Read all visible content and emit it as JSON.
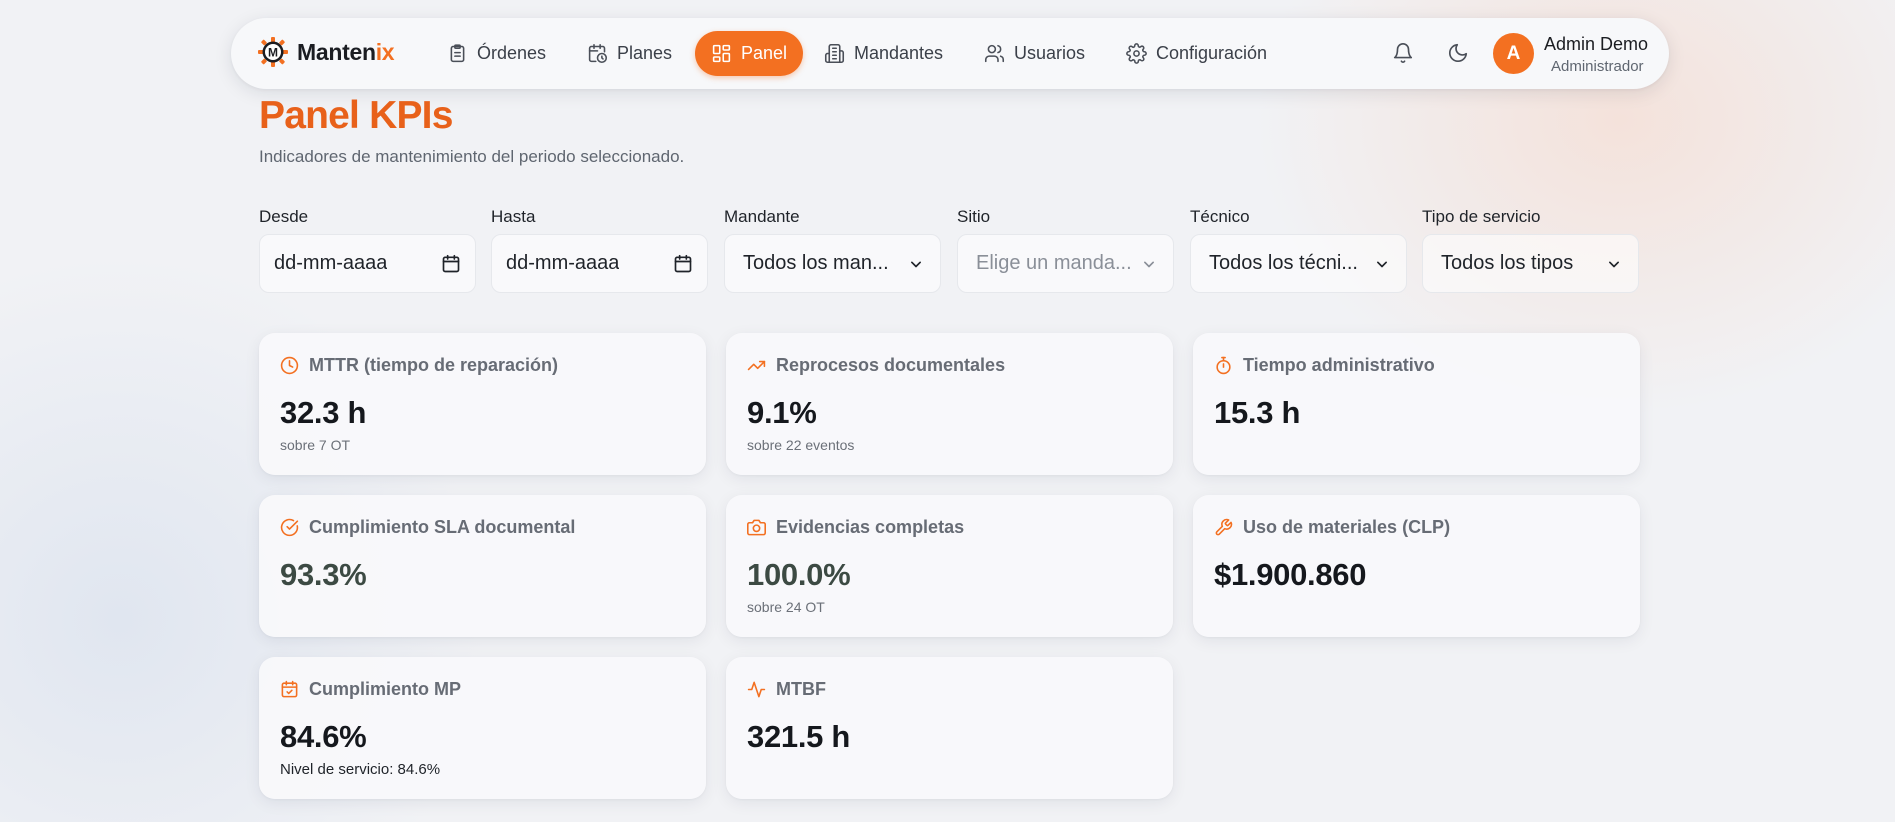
{
  "brand": {
    "part1": "Manten",
    "part2": "ix",
    "accent": "#f37021"
  },
  "nav": {
    "items": [
      {
        "label": "Órdenes",
        "icon": "clipboard-icon"
      },
      {
        "label": "Planes",
        "icon": "calendar-clock-icon"
      },
      {
        "label": "Panel",
        "icon": "dashboard-grid-icon",
        "active": true
      },
      {
        "label": "Mandantes",
        "icon": "building-icon"
      },
      {
        "label": "Usuarios",
        "icon": "users-icon"
      },
      {
        "label": "Configuración",
        "icon": "gear-icon"
      }
    ],
    "icons": [
      "bell-icon",
      "moon-icon"
    ]
  },
  "user": {
    "initial": "A",
    "name": "Admin Demo",
    "role": "Administrador"
  },
  "header": {
    "title": "Panel KPIs",
    "subtitle": "Indicadores de mantenimiento del periodo seleccionado."
  },
  "filters": [
    {
      "label": "Desde",
      "value": "dd-mm-aaaa",
      "type": "date"
    },
    {
      "label": "Hasta",
      "value": "dd-mm-aaaa",
      "type": "date"
    },
    {
      "label": "Mandante",
      "value": "Todos los man...",
      "type": "select"
    },
    {
      "label": "Sitio",
      "value": "Elige un manda...",
      "type": "select",
      "disabled": true
    },
    {
      "label": "Técnico",
      "value": "Todos los técni...",
      "type": "select"
    },
    {
      "label": "Tipo de servicio",
      "value": "Todos los tipos",
      "type": "select"
    }
  ],
  "kpis": [
    {
      "title": "MTTR (tiempo de reparación)",
      "value": "32.3 h",
      "sub": "sobre 7 OT",
      "icon": "clock-icon"
    },
    {
      "title": "Reprocesos documentales",
      "value": "9.1%",
      "sub": "sobre 22 eventos",
      "icon": "trending-up-icon"
    },
    {
      "title": "Tiempo administrativo",
      "value": "15.3 h",
      "sub": "",
      "icon": "stopwatch-icon"
    },
    {
      "title": "Cumplimiento SLA documental",
      "value": "93.3%",
      "sub": "",
      "icon": "check-circle-icon"
    },
    {
      "title": "Evidencias completas",
      "value": "100.0%",
      "sub": "sobre 24 OT",
      "icon": "camera-icon"
    },
    {
      "title": "Uso de materiales (CLP)",
      "value": "$1.900.860",
      "sub": "",
      "icon": "wrench-icon"
    },
    {
      "title": "Cumplimiento MP",
      "value": "84.6%",
      "sub": "Nivel de servicio: 84.6%",
      "icon": "calendar-check-icon"
    },
    {
      "title": "MTBF",
      "value": "321.5 h",
      "sub": "",
      "icon": "activity-icon"
    }
  ]
}
